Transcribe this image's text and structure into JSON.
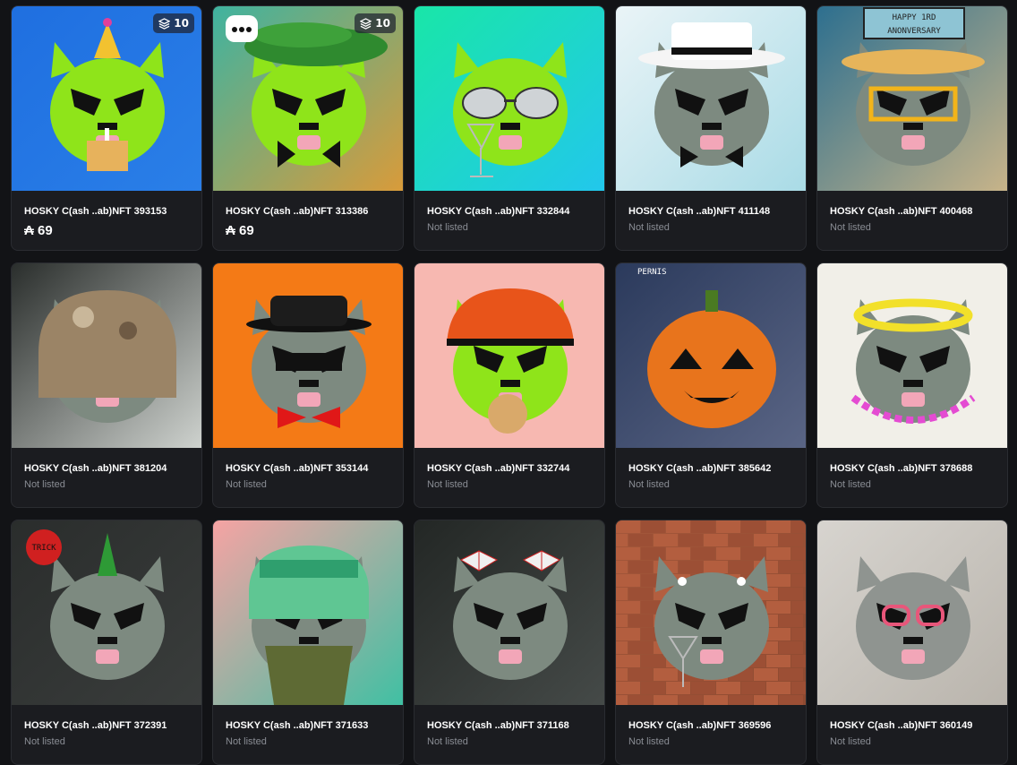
{
  "cards": [
    {
      "name": "HOSKY C(ash ..ab)NFT 393153",
      "price": "₳ 69",
      "status": "",
      "badge": "10",
      "bg1": "#1f6fe0",
      "bg2": "#2a7fe8",
      "face": "#8fe41a",
      "accessory": "party-hat",
      "accessory_icon": "party-hat-icon"
    },
    {
      "name": "HOSKY C(ash ..ab)NFT 313386",
      "price": "₳ 69",
      "status": "",
      "badge": "10",
      "bg1": "#3fb3a0",
      "bg2": "#d99b3a",
      "face": "#8fe41a",
      "accessory": "palm-hair",
      "accessory_icon": "palm-leaf-icon"
    },
    {
      "name": "HOSKY C(ash ..ab)NFT 332844",
      "price": "",
      "status": "Not listed",
      "badge": "",
      "bg1": "#19e6a8",
      "bg2": "#22c7ec",
      "face": "#8fe41a",
      "accessory": "aviator-glasses",
      "accessory_icon": "aviator-glasses-icon"
    },
    {
      "name": "HOSKY C(ash ..ab)NFT 411148",
      "price": "",
      "status": "Not listed",
      "badge": "",
      "bg1": "#eaf4f7",
      "bg2": "#a9dbe6",
      "face": "#7d8a80",
      "accessory": "white-fedora",
      "accessory_icon": "fedora-icon"
    },
    {
      "name": "HOSKY C(ash ..ab)NFT 400468",
      "price": "",
      "status": "Not listed",
      "badge": "",
      "bg1": "#2d6f8f",
      "bg2": "#c8b489",
      "face": "#7d8a80",
      "accessory": "anniversary-banner",
      "accessory_icon": "banner-icon",
      "banner_text": "HAPPY 1RD ANONVERSARY"
    },
    {
      "name": "HOSKY C(ash ..ab)NFT 381204",
      "price": "",
      "status": "Not listed",
      "badge": "",
      "bg1": "#2a2e2c",
      "bg2": "#cfd3cf",
      "face": "#7d8a80",
      "accessory": "camo-helmet",
      "accessory_icon": "helmet-icon"
    },
    {
      "name": "HOSKY C(ash ..ab)NFT 353144",
      "price": "",
      "status": "Not listed",
      "badge": "",
      "bg1": "#f47a16",
      "bg2": "#f47a16",
      "face": "#7d8a80",
      "accessory": "black-hat",
      "accessory_icon": "bowler-hat-icon"
    },
    {
      "name": "HOSKY C(ash ..ab)NFT 332744",
      "price": "",
      "status": "Not listed",
      "badge": "",
      "bg1": "#f7b8b1",
      "bg2": "#f7b8b1",
      "face": "#8fe41a",
      "accessory": "bike-helmet",
      "accessory_icon": "bike-helmet-icon"
    },
    {
      "name": "HOSKY C(ash ..ab)NFT 385642",
      "price": "",
      "status": "Not listed",
      "badge": "",
      "bg1": "#2b3a5c",
      "bg2": "#5a6585",
      "face": "#e8741c",
      "accessory": "pumpkin",
      "accessory_icon": "pumpkin-icon",
      "banner_text": "PERNIS"
    },
    {
      "name": "HOSKY C(ash ..ab)NFT 378688",
      "price": "",
      "status": "Not listed",
      "badge": "",
      "bg1": "#f1efe8",
      "bg2": "#f1efe8",
      "face": "#7d8a80",
      "accessory": "halo",
      "accessory_icon": "halo-icon"
    },
    {
      "name": "HOSKY C(ash ..ab)NFT 372391",
      "price": "",
      "status": "Not listed",
      "badge": "",
      "bg1": "#2a2d2c",
      "bg2": "#3a3d3c",
      "face": "#7d8a80",
      "accessory": "green-horn",
      "accessory_icon": "horn-icon",
      "banner_text": "TRICK"
    },
    {
      "name": "HOSKY C(ash ..ab)NFT 371633",
      "price": "",
      "status": "Not listed",
      "badge": "",
      "bg1": "#f6a3a3",
      "bg2": "#3fc0a3",
      "face": "#7d8a80",
      "accessory": "trapper-hat",
      "accessory_icon": "trapper-hat-icon"
    },
    {
      "name": "HOSKY C(ash ..ab)NFT 371168",
      "price": "",
      "status": "Not listed",
      "badge": "",
      "bg1": "#232725",
      "bg2": "#454a48",
      "face": "#7d8a80",
      "accessory": "bows",
      "accessory_icon": "bow-icon"
    },
    {
      "name": "HOSKY C(ash ..ab)NFT 369596",
      "price": "",
      "status": "Not listed",
      "badge": "",
      "bg1": "#a4573a",
      "bg2": "#8d4a31",
      "face": "#7d8a80",
      "accessory": "earbuds",
      "accessory_icon": "earbuds-icon"
    },
    {
      "name": "HOSKY C(ash ..ab)NFT 360149",
      "price": "",
      "status": "Not listed",
      "badge": "",
      "bg1": "#d7d4cf",
      "bg2": "#b9b4ac",
      "face": "#8f9490",
      "accessory": "pink-glasses",
      "accessory_icon": "glasses-icon"
    }
  ]
}
